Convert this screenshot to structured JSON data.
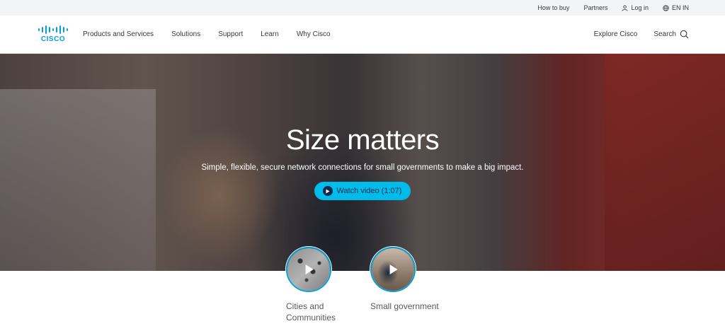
{
  "utility": {
    "how_to_buy": "How to buy",
    "partners": "Partners",
    "login": "Log in",
    "language": "EN IN"
  },
  "nav": {
    "logo_text": "CISCO",
    "links": [
      "Products and Services",
      "Solutions",
      "Support",
      "Learn",
      "Why Cisco"
    ],
    "explore": "Explore Cisco",
    "search": "Search"
  },
  "hero": {
    "title": "Size matters",
    "subtitle": "Simple, flexible, secure network connections for small governments to make a big impact.",
    "cta": "Watch video (1:07)"
  },
  "thumbs": [
    {
      "label": "Cities and Communities"
    },
    {
      "label": "Small government"
    }
  ],
  "colors": {
    "accent": "#049fd9",
    "cta": "#00bceb",
    "dark_text": "#0d274d"
  },
  "icons": [
    "user-icon",
    "globe-icon",
    "search-icon",
    "play-icon"
  ]
}
